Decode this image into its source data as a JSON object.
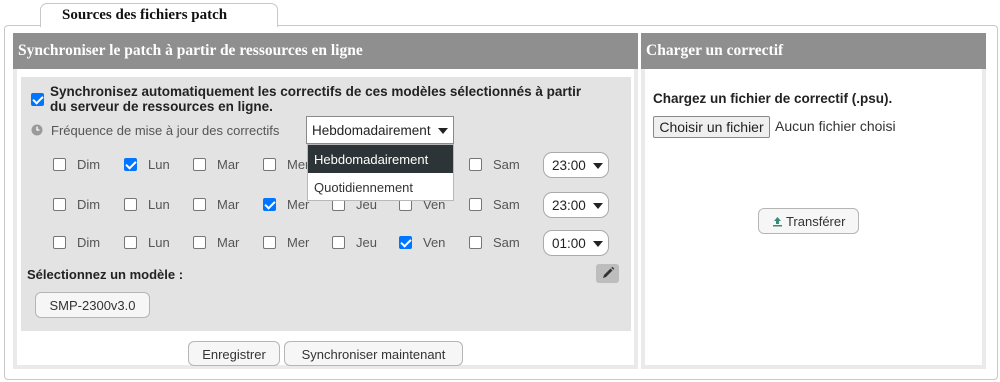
{
  "tab": {
    "label": "Sources des fichiers patch"
  },
  "left": {
    "title": "Synchroniser le patch à partir de ressources en ligne",
    "auto_sync": {
      "checked": true,
      "line1": "Synchronisez automatiquement les correctifs de ces modèles sélectionnés à partir",
      "line2": "du serveur de ressources en ligne."
    },
    "frequency": {
      "label": "Fréquence de mise à jour des correctifs",
      "value": "Hebdomadairement",
      "options": [
        "Hebdomadairement",
        "Quotidiennement"
      ]
    },
    "days": [
      "Dim",
      "Lun",
      "Mar",
      "Mer",
      "Jeu",
      "Ven",
      "Sam"
    ],
    "schedules": [
      {
        "checked": [
          false,
          true,
          false,
          false,
          false,
          false,
          false
        ],
        "time": "23:00"
      },
      {
        "checked": [
          false,
          false,
          false,
          true,
          false,
          false,
          false
        ],
        "time": "23:00"
      },
      {
        "checked": [
          false,
          false,
          false,
          false,
          false,
          true,
          false
        ],
        "time": "01:00"
      }
    ],
    "model_label": "Sélectionnez un modèle :",
    "model_value": "SMP-2300v3.0",
    "save_label": "Enregistrer",
    "sync_now_label": "Synchroniser maintenant"
  },
  "right": {
    "title": "Charger un correctif",
    "prompt": "Chargez un fichier de correctif (.psu).",
    "choose_label": "Choisir un fichier",
    "no_file": "Aucun fichier choisi",
    "transfer_label": "Transférer"
  },
  "colors": {
    "header": "#8f8f8f",
    "panel": "#eaeaea",
    "inner": "#e3e3e3",
    "accent": "#0075ff",
    "dropdown_active": "#2d3437"
  },
  "icons": [
    "clock-icon",
    "pencil-icon",
    "upload-icon",
    "caret-down-icon"
  ]
}
